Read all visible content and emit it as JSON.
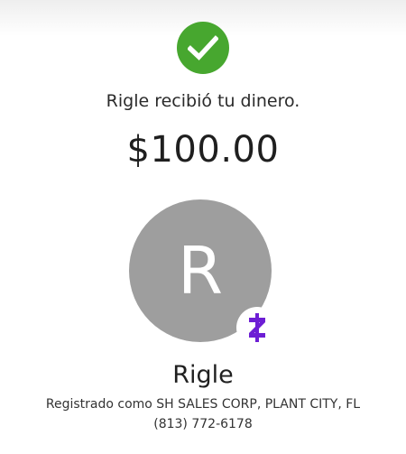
{
  "status": {
    "icon": "check-circle-icon",
    "icon_color": "#47a72f"
  },
  "confirmation": {
    "message": "Rigle recibió tu dinero.",
    "amount": "$100.00"
  },
  "recipient": {
    "avatar_initial": "R",
    "avatar_color": "#9e9e9e",
    "badge_icon": "zelle-logo-icon",
    "badge_color": "#6d1ed4",
    "name": "Rigle",
    "registered_as": "Registrado como SH SALES CORP, PLANT CITY, FL",
    "phone": "(813) 772-6178"
  }
}
